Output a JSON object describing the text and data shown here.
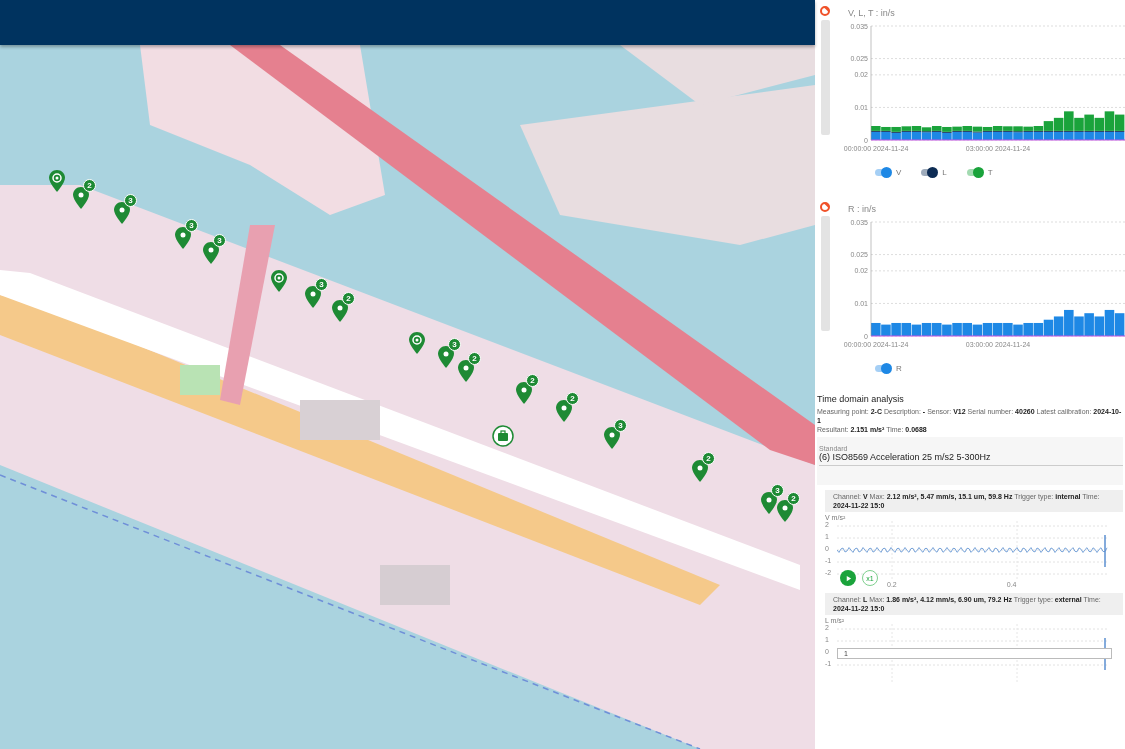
{
  "map": {
    "kind": "picture",
    "markers": [
      {
        "kind": "target"
      },
      {
        "kind": "pin",
        "count": "2"
      },
      {
        "kind": "pin",
        "count": "3"
      },
      {
        "kind": "pin",
        "count": "3"
      },
      {
        "kind": "pin",
        "count": "3"
      },
      {
        "kind": "target"
      },
      {
        "kind": "pin",
        "count": "3"
      },
      {
        "kind": "pin",
        "count": "2"
      },
      {
        "kind": "target"
      },
      {
        "kind": "pin",
        "count": "3"
      },
      {
        "kind": "pin",
        "count": "2"
      },
      {
        "kind": "pin",
        "count": "2"
      },
      {
        "kind": "pin",
        "count": "2"
      },
      {
        "kind": "bag"
      },
      {
        "kind": "pin",
        "count": "3"
      },
      {
        "kind": "pin",
        "count": "2"
      },
      {
        "kind": "pin",
        "count": "3"
      },
      {
        "kind": "pin",
        "count": "2"
      }
    ]
  },
  "trend_charts": [
    {
      "legend": [
        {
          "on": true
        },
        {
          "on": true
        },
        {
          "on": true
        }
      ],
      "chart_data": {
        "type": "bar",
        "stacked": true,
        "grid": true,
        "legend": true,
        "title": "V, L, T : in/s",
        "categories": [
          "00:00:00 2024-11-24",
          null,
          null,
          null,
          null,
          null,
          null,
          null,
          null,
          null,
          null,
          null,
          "03:00:00 2024-11-24",
          null,
          null,
          null,
          null,
          null,
          null,
          null,
          null,
          null,
          null,
          null,
          null
        ],
        "ylim": [
          0,
          0.035
        ],
        "yticks": [
          0,
          0.01,
          0.02,
          0.025,
          0.035
        ],
        "series": [
          {
            "name": "V",
            "color": "#1e88e5",
            "values": [
              0.0025,
              0.0025,
              0.0022,
              0.0025,
              0.0025,
              0.0024,
              0.0025,
              0.0022,
              0.0025,
              0.0025,
              0.0023,
              0.0025,
              0.0025,
              0.0025,
              0.0024,
              0.0025,
              0.0025,
              0.0025,
              0.0025,
              0.0025,
              0.0025,
              0.0025,
              0.0025,
              0.0025,
              0.0025
            ]
          },
          {
            "name": "L",
            "color": "#0d2c54",
            "values": [
              0.0003,
              0.0003,
              0.0003,
              0.0003,
              0.0003,
              0.0003,
              0.0003,
              0.0003,
              0.0003,
              0.0003,
              0.0003,
              0.0003,
              0.0003,
              0.0003,
              0.0003,
              0.0003,
              0.0003,
              0.0003,
              0.0003,
              0.0003,
              0.0003,
              0.0003,
              0.0003,
              0.0003,
              0.0003
            ]
          },
          {
            "name": "T",
            "color": "#1aa33b",
            "values": [
              0.0015,
              0.0012,
              0.0015,
              0.0014,
              0.0015,
              0.0012,
              0.0015,
              0.0015,
              0.0013,
              0.0015,
              0.0015,
              0.0012,
              0.0015,
              0.0014,
              0.0015,
              0.0013,
              0.0015,
              0.003,
              0.004,
              0.006,
              0.004,
              0.005,
              0.004,
              0.006,
              0.005
            ]
          }
        ]
      }
    },
    {
      "legend": [
        {
          "on": true
        }
      ],
      "chart_data": {
        "type": "bar",
        "stacked": false,
        "grid": true,
        "legend": true,
        "title": "R : in/s",
        "categories": [
          "00:00:00 2024-11-24",
          null,
          null,
          null,
          null,
          null,
          null,
          null,
          null,
          null,
          null,
          null,
          "03:00:00 2024-11-24",
          null,
          null,
          null,
          null,
          null,
          null,
          null,
          null,
          null,
          null,
          null,
          null
        ],
        "ylim": [
          0,
          0.035
        ],
        "yticks": [
          0,
          0.01,
          0.02,
          0.025,
          0.035
        ],
        "series": [
          {
            "name": "R",
            "color": "#1e88e5",
            "values": [
              0.004,
              0.0035,
              0.004,
              0.004,
              0.0035,
              0.004,
              0.004,
              0.0035,
              0.004,
              0.004,
              0.0035,
              0.004,
              0.004,
              0.004,
              0.0035,
              0.004,
              0.004,
              0.005,
              0.006,
              0.008,
              0.006,
              0.007,
              0.006,
              0.008,
              0.007
            ]
          }
        ]
      }
    }
  ],
  "analysis": {
    "title": "Time domain analysis",
    "info_lines": [
      "Measuring point: **2-C**   Description: **-**   Sensor: **V12**   Serial number: **40260**   Latest calibration: **2024-10-1**",
      "Resultant: **2.151 m/s²**   Time: **0.0688**"
    ],
    "standard": {
      "label": "Standard",
      "value": "(6) ISO8569 Acceleration 25 m/s2 5-300Hz"
    },
    "channels": [
      {
        "info": "Channel: **V** Max: **2.12 m/s², 5.47 mm/s, 15.1 um, 59.8 Hz** Trigger type: **internal** Time: **2024-11-22 15:0**",
        "axis_label": "V m/s²",
        "yticks": [
          "2",
          "1",
          "0",
          "-1",
          "-2"
        ],
        "xticks": [
          "0.2",
          "0.4"
        ],
        "speed": "x1"
      },
      {
        "info": "Channel: **L** Max: **1.86 m/s², 4.12 mm/s, 6.90 um, 79.2 Hz** Trigger type: **external** Time: **2024-11-22 15:0**",
        "axis_label": "L m/s²",
        "yticks": [
          "2",
          "1",
          "0",
          "-1"
        ],
        "cursor_label": "1"
      }
    ]
  }
}
